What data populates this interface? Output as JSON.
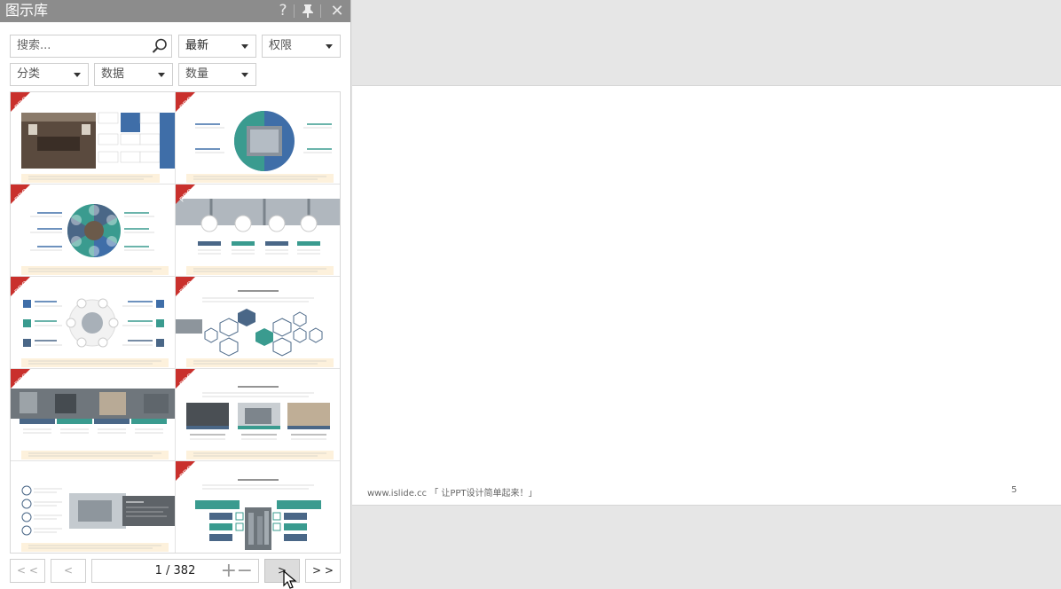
{
  "panel": {
    "title": "图示库",
    "help_icon": "help-icon",
    "pin_icon": "pin-icon",
    "close_icon": "close-icon"
  },
  "filters": {
    "search_placeholder": "搜索...",
    "sort": "最新",
    "permission": "权限",
    "category": "分类",
    "data": "数据",
    "quantity": "数量"
  },
  "thumbnails": [
    {
      "badge": "PRO"
    },
    {
      "badge": "PRO"
    },
    {
      "badge": "PRO"
    },
    {
      "badge": "PRO"
    },
    {
      "badge": "PRO"
    },
    {
      "badge": "PRO"
    },
    {
      "badge": "PRO"
    },
    {
      "badge": "PRO"
    },
    {
      "badge": ""
    },
    {
      "badge": "PRO"
    }
  ],
  "pager": {
    "first": "< <",
    "prev": "<",
    "info": "1 / 382",
    "next": ">",
    "last": "> >"
  },
  "slide": {
    "footer": "www.islide.cc 「 让PPT设计简单起来！」",
    "page_number": "5"
  },
  "colors": {
    "titlebar": "#8c8c8c",
    "pro_badge": "#c9302c",
    "blue": "#3f6ea8",
    "teal": "#3a9b8f",
    "slate": "#4a6787"
  }
}
